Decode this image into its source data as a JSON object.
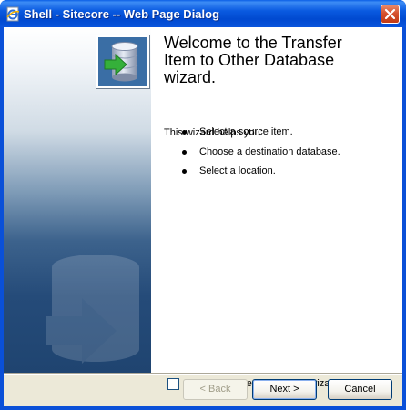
{
  "window": {
    "title": "Shell - Sitecore -- Web Page Dialog"
  },
  "wizard": {
    "heading": "Welcome to the Transfer Item to Other Database wizard.",
    "intro": "This wizard helps you:",
    "steps": [
      "Select a source item.",
      "Choose a destination database.",
      "Select a location."
    ],
    "skip_label": "Always skip the first page of wizards",
    "skip_checked": false
  },
  "buttons": {
    "back": "< Back",
    "next": "Next >",
    "cancel": "Cancel"
  },
  "icons": {
    "app": "ie-page-icon",
    "close": "close-icon",
    "wizard": "database-transfer-icon"
  },
  "colors": {
    "titlebar": "#0a50d8",
    "close_button": "#d6512e",
    "sidebar_dark": "#254b79",
    "client_bg": "#ece9d8"
  }
}
